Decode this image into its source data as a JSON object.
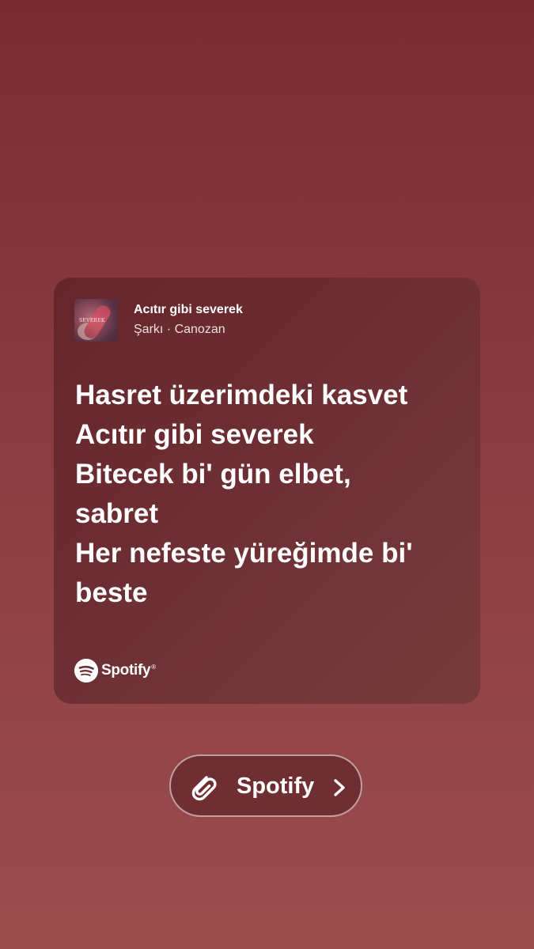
{
  "card": {
    "track_title": "Acıtır gibi severek",
    "track_subtitle": "Şarkı · Canozan",
    "album_art_text": "SEVEREK",
    "lyrics": [
      "Hasret üzerimdeki kasvet",
      "Acıtır gibi severek",
      "Bitecek bi' gün elbet,",
      "sabret",
      "Her nefeste yüreğimde bi'",
      "beste"
    ],
    "brand_label": "Spotify",
    "brand_mark": "®",
    "brand_icon": "spotify-icon"
  },
  "link_sticker": {
    "label": "Spotify",
    "icon": "paperclip-icon",
    "chevron": "chevron-right-icon"
  },
  "colors": {
    "background_top": "#772c31",
    "background_bottom": "#9a4d4d",
    "card": "#6c2e33",
    "text": "#ffffff"
  }
}
